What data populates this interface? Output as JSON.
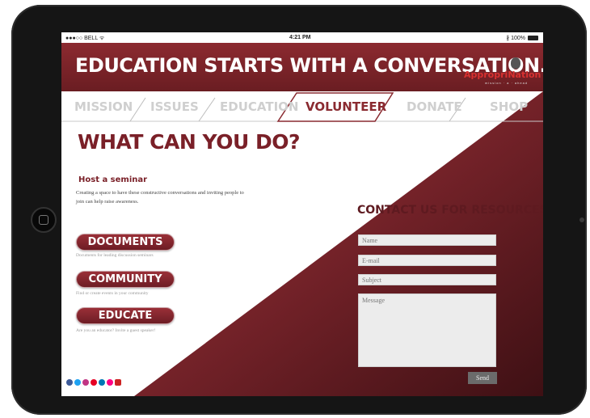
{
  "status_bar": {
    "carrier": "●●●○○ BELL ᯤ",
    "time": "4:21 PM",
    "battery": "∦ 100%"
  },
  "banner": {
    "title": "EDUCATION STARTS WITH A CONVERSATION.",
    "logo_text": "AppropriNation",
    "logo_tagline": "mission · a · ahead"
  },
  "nav": {
    "items": [
      {
        "label": "MISSION",
        "active": false
      },
      {
        "label": "ISSUES",
        "active": false
      },
      {
        "label": "EDUCATION",
        "active": false
      },
      {
        "label": "VOLUNTEER",
        "active": true
      },
      {
        "label": "DONATE",
        "active": false
      },
      {
        "label": "SHOP",
        "active": false
      }
    ]
  },
  "main": {
    "heading": "WHAT CAN YOU DO?",
    "sub_heading": "Host a seminar",
    "description": "Creating a space to have these constructive conversations and inviting people to join can help raise awareness.",
    "buttons": [
      {
        "label": "DOCUMENTS",
        "caption": "Documents for leading discussion seminars"
      },
      {
        "label": "COMMUNITY",
        "caption": "Find or create events in your community"
      },
      {
        "label": "EDUCATE",
        "caption": "Are you an educator? Invite a guest speaker!"
      }
    ]
  },
  "social_icons": [
    "facebook-icon",
    "twitter-icon",
    "instagram-icon",
    "pinterest-icon",
    "linkedin-icon",
    "flickr-icon",
    "youtube-icon"
  ],
  "contact": {
    "title": "CONTACT US FOR RESOURCES",
    "name_placeholder": "Name",
    "email_placeholder": "E-mail",
    "subject_placeholder": "Subject",
    "message_placeholder": "Message",
    "send_label": "Send"
  },
  "colors": {
    "brand": "#7a2028",
    "banner": "#8c2a30",
    "panel_dark": "#4a1418",
    "nav_inactive": "#cfcfcf",
    "tablet_frame": "#151515"
  }
}
